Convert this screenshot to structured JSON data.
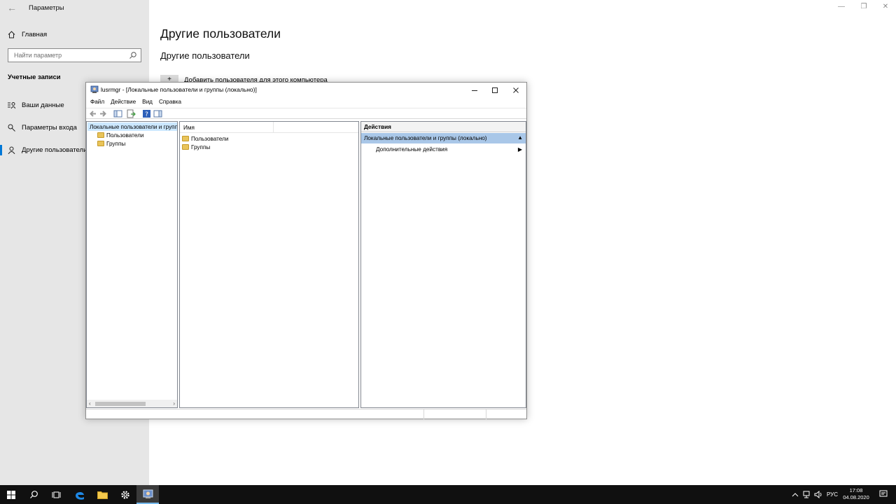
{
  "settings": {
    "title": "Параметры",
    "home_label": "Главная",
    "search_placeholder": "Найти параметр",
    "section_label": "Учетные записи",
    "nav": [
      {
        "label": "Ваши данные",
        "icon": "person-list-icon"
      },
      {
        "label": "Параметры входа",
        "icon": "key-icon"
      },
      {
        "label": "Другие пользователи",
        "icon": "person-icon"
      }
    ],
    "page_title": "Другие пользователи",
    "page_subtitle": "Другие пользователи",
    "add_user_label": "Добавить пользователя для этого компьютера"
  },
  "mmc": {
    "title": "lusrmgr - [Локальные пользователи и группы (локально)]",
    "menu": [
      "Файл",
      "Действие",
      "Вид",
      "Справка"
    ],
    "tree": {
      "root": "Локальные пользователи и группы (локально)",
      "children": [
        "Пользователи",
        "Группы"
      ]
    },
    "list": {
      "column_header": "Имя",
      "rows": [
        "Пользователи",
        "Группы"
      ]
    },
    "actions": {
      "header": "Действия",
      "selected": "Локальные пользователи и группы (локально)",
      "item": "Дополнительные действия"
    }
  },
  "taskbar": {
    "lang": "РУС",
    "time": "17:08",
    "date": "04.08.2020"
  }
}
